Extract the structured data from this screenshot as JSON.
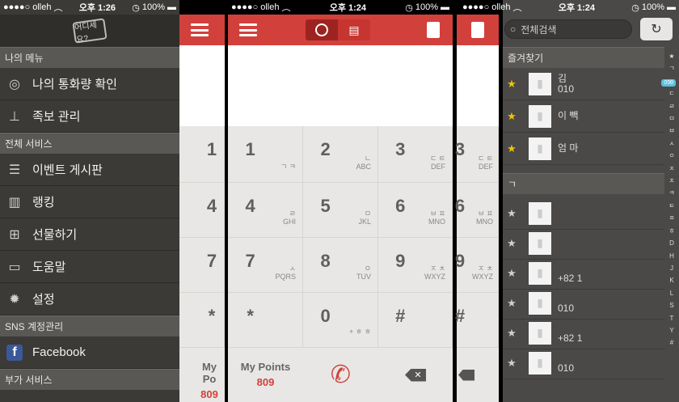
{
  "status_left": {
    "carrier": "olleh",
    "time": "오후 1:26",
    "battery": "100%"
  },
  "status_mid": {
    "carrier": "olleh",
    "time": "오후 1:24",
    "battery": "100%"
  },
  "status_right": {
    "carrier": "olleh",
    "time": "오후 1:24",
    "battery": "100%"
  },
  "logo_text": "어디세요?",
  "menu": {
    "section1": "나의 메뉴",
    "item_calls": "나의 통화량 확인",
    "item_tree": "족보 관리",
    "section2": "전체 서비스",
    "item_events": "이벤트 게시판",
    "item_ranking": "랭킹",
    "item_gift": "선물하기",
    "item_help": "도움말",
    "item_settings": "설정",
    "section3": "SNS 계정관리",
    "item_facebook": "Facebook",
    "section4": "부가 서비스"
  },
  "dialer": {
    "keys": [
      {
        "d": "1",
        "s": "ㄱ ㅋ"
      },
      {
        "d": "2",
        "s": "ㄴ\nABC"
      },
      {
        "d": "3",
        "s": "ㄷ ㅌ\nDEF"
      },
      {
        "d": "4",
        "s": "ㄹ\nGHI"
      },
      {
        "d": "5",
        "s": "ㅁ\nJKL"
      },
      {
        "d": "6",
        "s": "ㅂ ㅍ\nMNO"
      },
      {
        "d": "7",
        "s": "ㅅ\nPQRS"
      },
      {
        "d": "8",
        "s": "ㅇ\nTUV"
      },
      {
        "d": "9",
        "s": "ㅈ ㅊ\nWXYZ"
      },
      {
        "d": "*",
        "s": ""
      },
      {
        "d": "0",
        "s": "+    ㅎ ㅎ"
      },
      {
        "d": "#",
        "s": ""
      }
    ],
    "points_label": "My Points",
    "points_value": "809",
    "edge_digits": [
      "1",
      "4",
      "7",
      "*"
    ],
    "edge_right": [
      {
        "d": "3",
        "s": "ㄷ ㅌ\nDEF"
      },
      {
        "d": "6",
        "s": "ㅂ ㅍ\nMNO"
      },
      {
        "d": "9",
        "s": "ㅈ ㅊ\nWXYZ"
      },
      {
        "d": "#",
        "s": ""
      }
    ],
    "edge_points_label": "My Po",
    "edge_points_value": "809"
  },
  "contacts": {
    "search_placeholder": "전체검색",
    "favorites_header": "즐겨찾기",
    "group_header": "ㄱ",
    "badge": "050",
    "rows": [
      {
        "name": "김",
        "sub": "010",
        "fav": true
      },
      {
        "name": "이 빽",
        "sub": "",
        "fav": true
      },
      {
        "name": "엄 마",
        "sub": "",
        "fav": true
      },
      {
        "name": "",
        "sub": "",
        "fav": false
      },
      {
        "name": "",
        "sub": "",
        "fav": false
      },
      {
        "name": "",
        "sub": "+82 1",
        "fav": false
      },
      {
        "name": "",
        "sub": "010",
        "fav": false
      },
      {
        "name": "",
        "sub": "+82 1",
        "fav": false
      },
      {
        "name": "",
        "sub": "010",
        "fav": false
      }
    ],
    "index": [
      "★",
      "ㄱ",
      "ㄴ",
      "ㄷ",
      "ㄹ",
      "ㅁ",
      "ㅂ",
      "ㅅ",
      "ㅇ",
      "ㅈ",
      "ㅊ",
      "ㅋ",
      "ㅌ",
      "ㅍ",
      "ㅎ",
      "D",
      "H",
      "J",
      "K",
      "L",
      "S",
      "T",
      "Y",
      "#"
    ]
  },
  "colors": {
    "accent": "#d2403c",
    "star_fav": "#f2c200"
  }
}
